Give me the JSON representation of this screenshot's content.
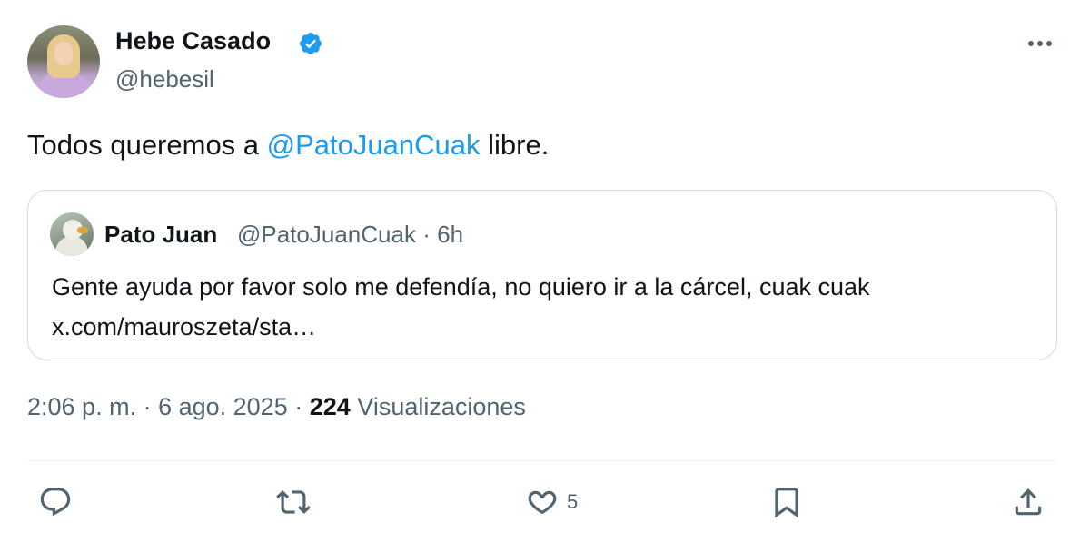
{
  "author": {
    "name": "Hebe Casado",
    "handle": "@hebesil",
    "verified_icon": "verified-badge-icon"
  },
  "tweet": {
    "text_before": "Todos queremos a ",
    "mention": "@PatoJuanCuak",
    "text_after": " libre."
  },
  "quoted_tweet": {
    "name": "Pato Juan",
    "handle": "@PatoJuanCuak",
    "separator": "·",
    "time": "6h",
    "text_line1": "Gente ayuda por favor solo me defendía, no quiero ir a la cárcel, cuak cuak",
    "text_line2": "x.com/mauroszeta/sta…"
  },
  "meta": {
    "time": "2:06 p. m.",
    "date": "6 ago. 2025",
    "views_count": "224",
    "views_label": "Visualizaciones"
  },
  "actions": {
    "like_count": "5"
  },
  "colors": {
    "accent": "#1d9bf0",
    "secondary_text": "#536471",
    "border": "#cfd9de"
  }
}
